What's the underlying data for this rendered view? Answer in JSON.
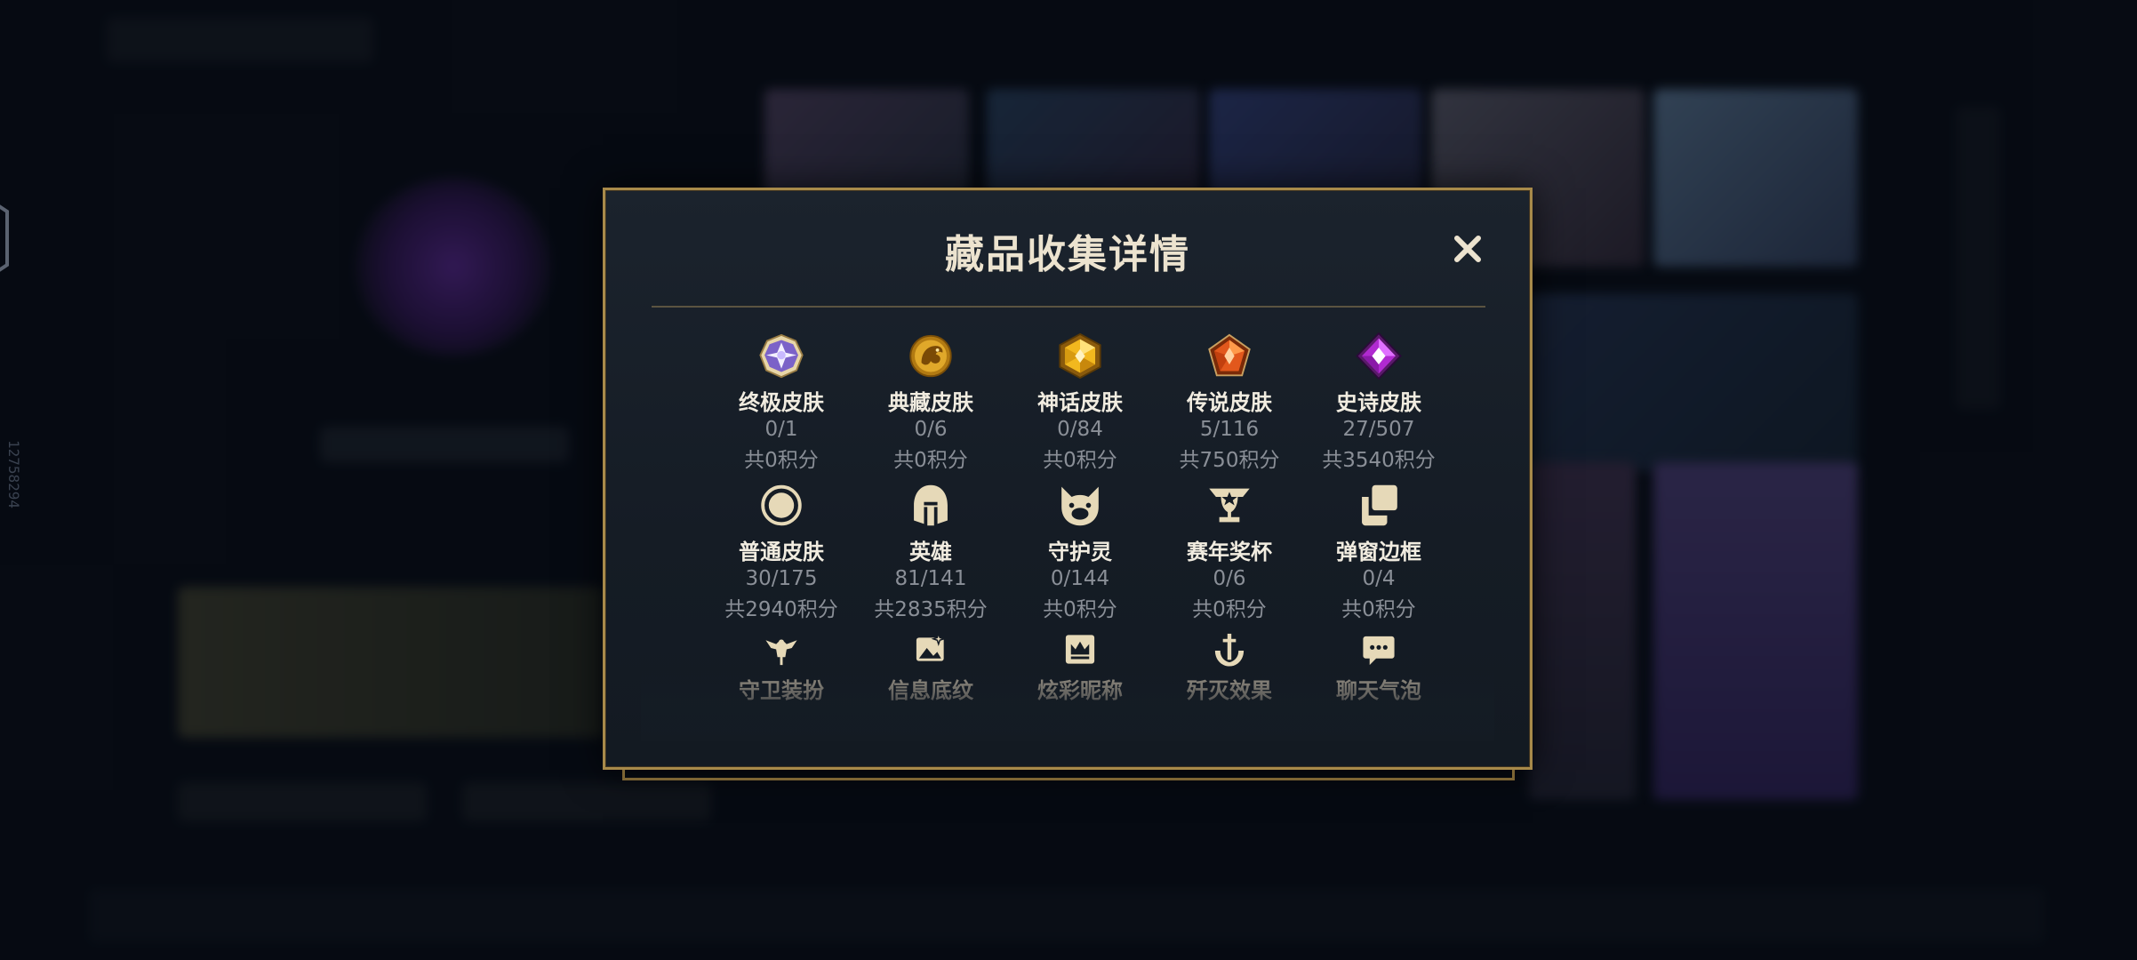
{
  "side_number": "12758294",
  "modal": {
    "title": "藏品收集详情",
    "close_label": "✕"
  },
  "items": [
    {
      "label": "终极皮肤",
      "count": "0/1",
      "points": "共0积分",
      "icon": "ultimate-gem-icon"
    },
    {
      "label": "典藏皮肤",
      "count": "0/6",
      "points": "共0积分",
      "icon": "dragon-coin-icon"
    },
    {
      "label": "神话皮肤",
      "count": "0/84",
      "points": "共0积分",
      "icon": "mythic-gem-icon"
    },
    {
      "label": "传说皮肤",
      "count": "5/116",
      "points": "共750积分",
      "icon": "legendary-gem-icon"
    },
    {
      "label": "史诗皮肤",
      "count": "27/507",
      "points": "共3540积分",
      "icon": "epic-gem-icon"
    },
    {
      "label": "普通皮肤",
      "count": "30/175",
      "points": "共2940积分",
      "icon": "ring-icon"
    },
    {
      "label": "英雄",
      "count": "81/141",
      "points": "共2835积分",
      "icon": "helmet-icon"
    },
    {
      "label": "守护灵",
      "count": "0/144",
      "points": "共0积分",
      "icon": "cat-face-icon"
    },
    {
      "label": "赛年奖杯",
      "count": "0/6",
      "points": "共0积分",
      "icon": "trophy-icon"
    },
    {
      "label": "弹窗边框",
      "count": "0/4",
      "points": "共0积分",
      "icon": "frames-icon"
    },
    {
      "label": "守卫装扮",
      "icon": "ward-icon"
    },
    {
      "label": "信息底纹",
      "icon": "picture-sparkle-icon"
    },
    {
      "label": "炫彩昵称",
      "icon": "crown-card-icon"
    },
    {
      "label": "歼灭效果",
      "icon": "anchor-sword-icon"
    },
    {
      "label": "聊天气泡",
      "icon": "chat-bubble-icon"
    }
  ],
  "colors": {
    "gold": "#a88a4a",
    "icon_tan": "#e6d9b8",
    "text_light": "#f1ece0",
    "text_muted": "#8a8f97"
  }
}
